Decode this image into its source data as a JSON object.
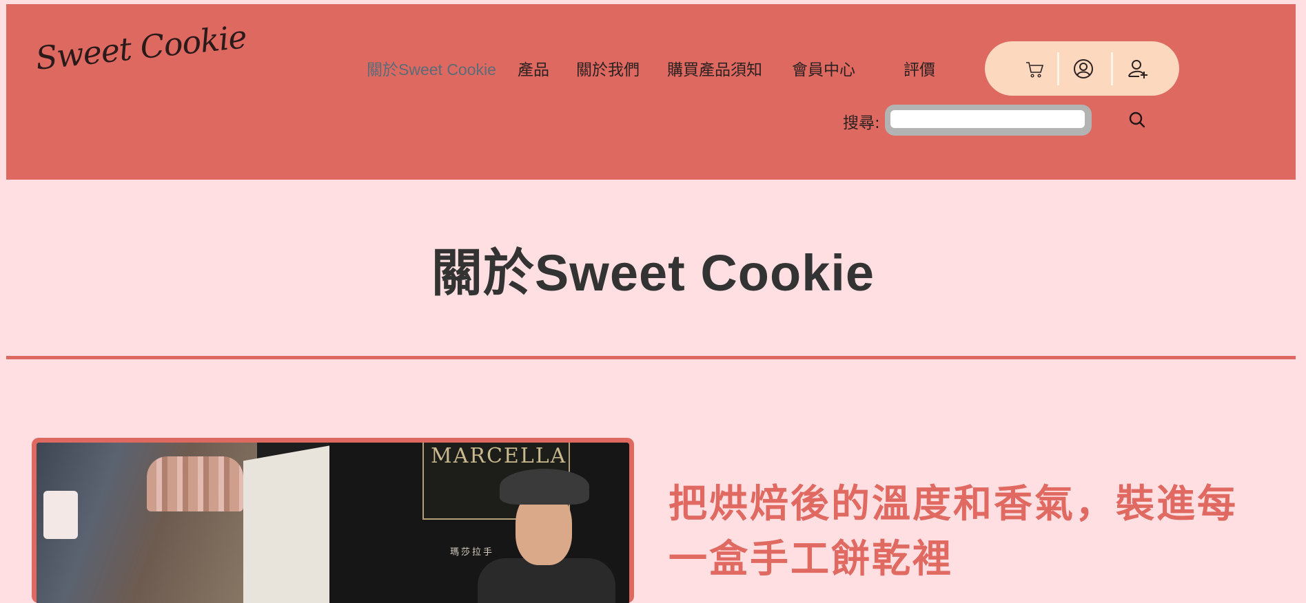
{
  "header": {
    "logo_text": "Sweet Cookie",
    "nav": [
      {
        "label": "關於Sweet Cookie",
        "active": true
      },
      {
        "label": "產品",
        "active": false
      },
      {
        "label": "關於我們",
        "active": false
      },
      {
        "label": "購買產品須知",
        "active": false
      },
      {
        "label": "會員中心",
        "active": false
      },
      {
        "label": "評價",
        "active": false
      }
    ],
    "actions": [
      "cart-icon",
      "user-icon",
      "user-add-icon"
    ],
    "search": {
      "label": "搜尋:",
      "value": "",
      "placeholder": ""
    }
  },
  "main": {
    "page_title": "關於Sweet Cookie",
    "photo": {
      "sign_text": "MARCELLA",
      "sign_sub": "瑪莎拉手"
    },
    "tagline": "把烘焙後的溫度和香氣，裝進每一盒手工餅乾裡"
  },
  "colors": {
    "header_bg": "#de6961",
    "page_bg": "#ffdfe1",
    "actions_bg": "#fcd8bf",
    "accent": "#e06a62",
    "title_text": "#333333"
  }
}
